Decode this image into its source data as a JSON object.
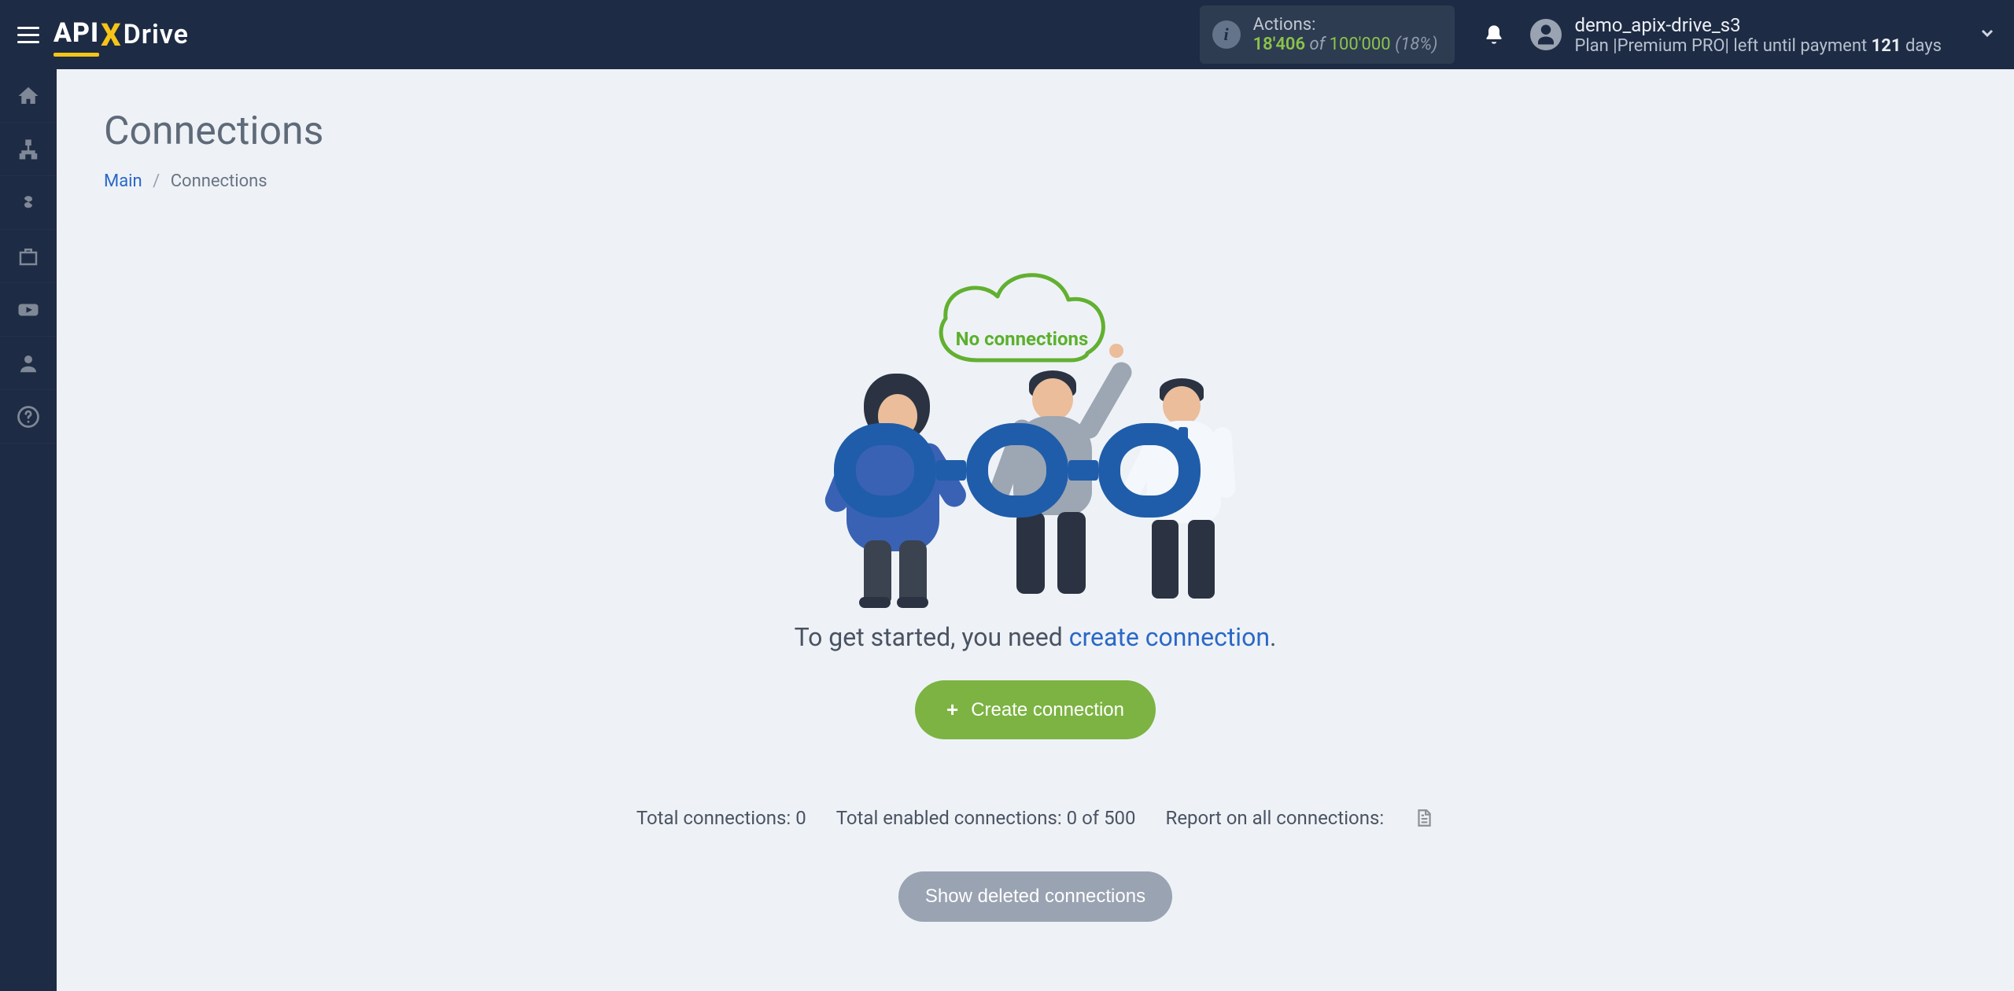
{
  "header": {
    "brand_part1": "API",
    "brand_part2": "Drive",
    "actions": {
      "label": "Actions:",
      "used": "18'406",
      "of": "of",
      "total": "100'000",
      "pct": "(18%)"
    },
    "account": {
      "name": "demo_apix-drive_s3",
      "plan_prefix": "Plan |",
      "plan_name": "Premium PRO",
      "plan_sep": "|",
      "left_text": "left until payment",
      "days_num": "121",
      "days_word": "days"
    }
  },
  "sidebar": {
    "items": [
      {
        "name": "home"
      },
      {
        "name": "connections"
      },
      {
        "name": "payments"
      },
      {
        "name": "toolbox"
      },
      {
        "name": "video"
      },
      {
        "name": "account"
      },
      {
        "name": "help"
      }
    ]
  },
  "page": {
    "title": "Connections",
    "breadcrumbs": {
      "main": "Main",
      "current": "Connections"
    },
    "empty": {
      "cloud_text": "No connections",
      "lead_text": "To get started, you need ",
      "lead_link": "create connection",
      "period": ".",
      "create_button": "Create connection",
      "stats": {
        "total_label": "Total connections:",
        "total_value": "0",
        "enabled_label": "Total enabled connections:",
        "enabled_value": "0",
        "enabled_of": "of",
        "enabled_limit": "500",
        "report_label": "Report on all connections:"
      },
      "deleted_button": "Show deleted connections"
    }
  }
}
